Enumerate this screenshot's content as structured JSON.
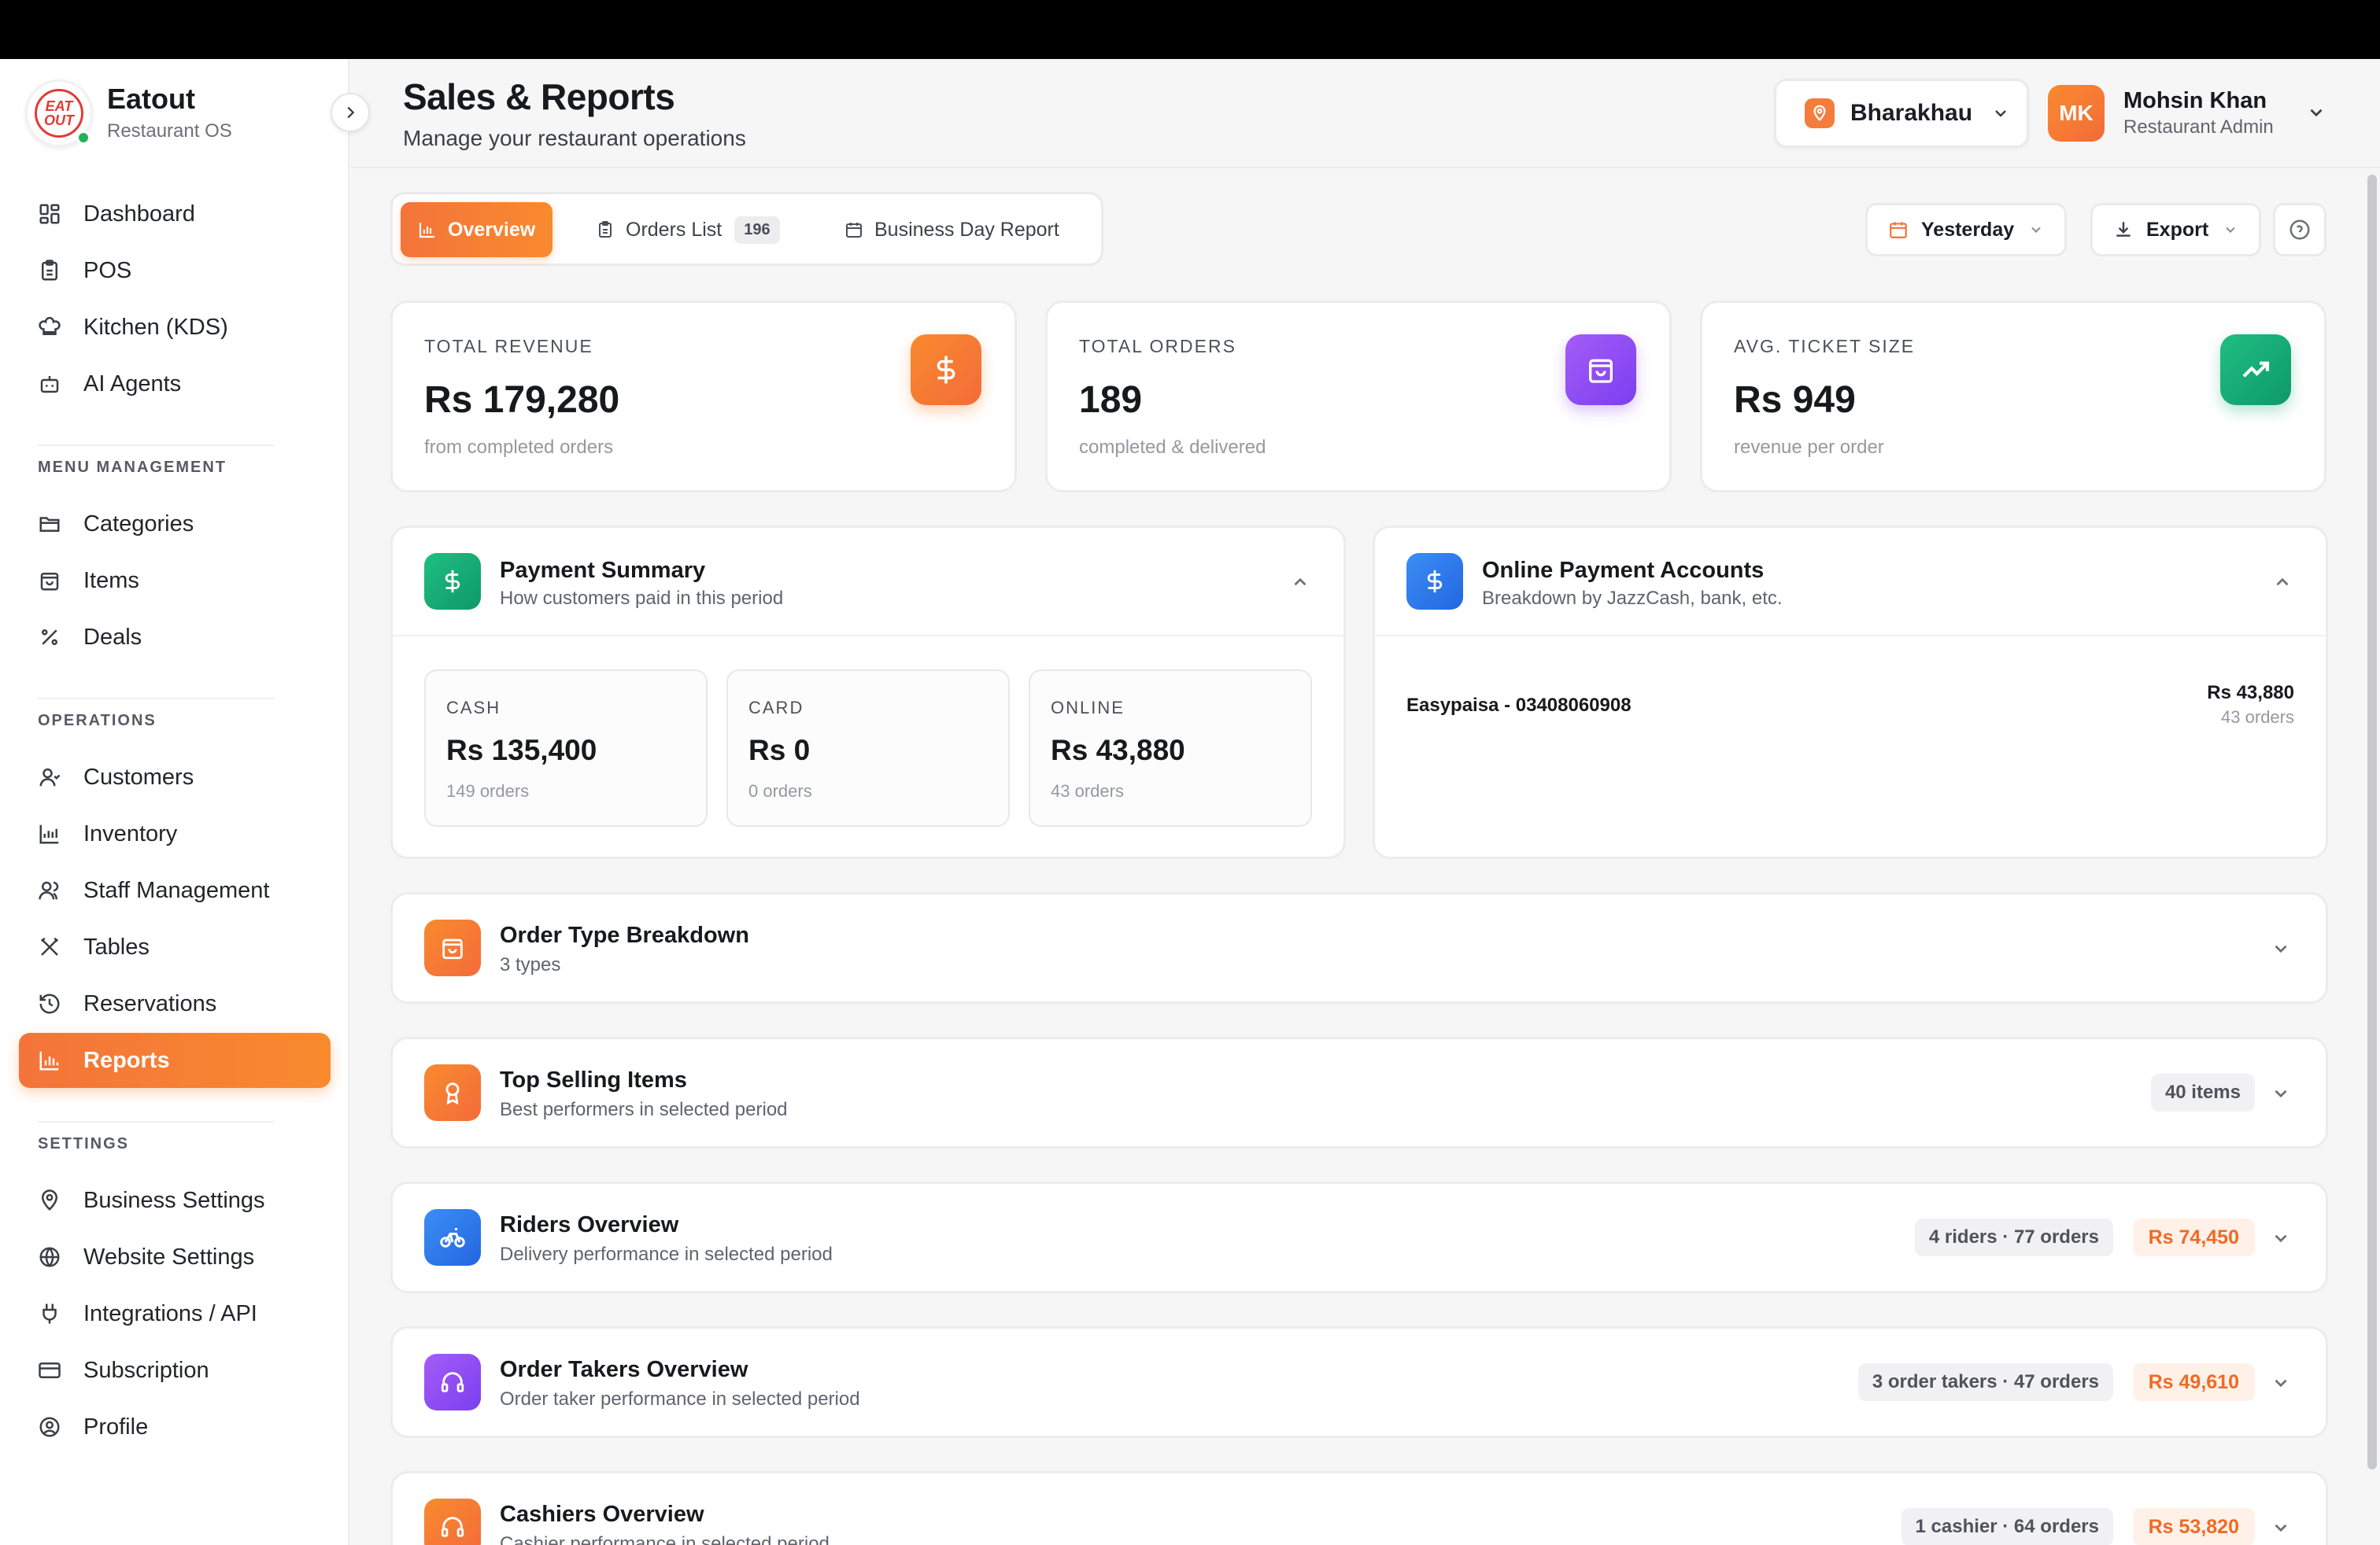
{
  "brand": {
    "name": "Eatout",
    "subtitle": "Restaurant OS",
    "logo_text": "EAT OUT"
  },
  "sidebar": {
    "main": [
      {
        "label": "Dashboard",
        "icon": "dashboard-icon"
      },
      {
        "label": "POS",
        "icon": "clipboard-icon"
      },
      {
        "label": "Kitchen (KDS)",
        "icon": "chef-hat-icon"
      },
      {
        "label": "AI Agents",
        "icon": "bot-icon"
      }
    ],
    "menu_section": "MENU MANAGEMENT",
    "menu": [
      {
        "label": "Categories",
        "icon": "folder-icon"
      },
      {
        "label": "Items",
        "icon": "bag-icon"
      },
      {
        "label": "Deals",
        "icon": "percent-icon"
      }
    ],
    "ops_section": "OPERATIONS",
    "ops": [
      {
        "label": "Customers",
        "icon": "user-icon"
      },
      {
        "label": "Inventory",
        "icon": "chart-icon"
      },
      {
        "label": "Staff Management",
        "icon": "users-icon"
      },
      {
        "label": "Tables",
        "icon": "utensils-icon"
      },
      {
        "label": "Reservations",
        "icon": "history-icon"
      },
      {
        "label": "Reports",
        "icon": "bar-chart-icon",
        "active": true
      }
    ],
    "settings_section": "SETTINGS",
    "settings": [
      {
        "label": "Business Settings",
        "icon": "map-pin-icon"
      },
      {
        "label": "Website Settings",
        "icon": "globe-icon"
      },
      {
        "label": "Integrations / API",
        "icon": "plug-icon"
      },
      {
        "label": "Subscription",
        "icon": "credit-card-icon"
      },
      {
        "label": "Profile",
        "icon": "user-circle-icon"
      }
    ]
  },
  "header": {
    "title": "Sales & Reports",
    "subtitle": "Manage your restaurant operations",
    "branch": "Bharakhau",
    "user_initials": "MK",
    "user_name": "Mohsin Khan",
    "user_role": "Restaurant Admin"
  },
  "tabs": [
    {
      "label": "Overview",
      "active": true
    },
    {
      "label": "Orders List",
      "badge": "196"
    },
    {
      "label": "Business Day Report"
    }
  ],
  "controls": {
    "date_range": "Yesterday",
    "export": "Export"
  },
  "stats": [
    {
      "label": "TOTAL REVENUE",
      "value": "Rs 179,280",
      "sub": "from completed orders",
      "color": "#f97a2e"
    },
    {
      "label": "TOTAL ORDERS",
      "value": "189",
      "sub": "completed & delivered",
      "color": "#8b45f0"
    },
    {
      "label": "AVG. TICKET SIZE",
      "value": "Rs 949",
      "sub": "revenue per order",
      "color": "#12a873"
    }
  ],
  "payment_summary": {
    "title": "Payment Summary",
    "subtitle": "How customers paid in this period",
    "boxes": [
      {
        "label": "CASH",
        "value": "Rs 135,400",
        "sub": "149 orders"
      },
      {
        "label": "CARD",
        "value": "Rs 0",
        "sub": "0 orders"
      },
      {
        "label": "ONLINE",
        "value": "Rs 43,880",
        "sub": "43 orders"
      }
    ]
  },
  "online_accounts": {
    "title": "Online Payment Accounts",
    "subtitle": "Breakdown by JazzCash, bank, etc.",
    "accounts": [
      {
        "name": "Easypaisa - 03408060908",
        "amount": "Rs 43,880",
        "orders": "43 orders"
      }
    ]
  },
  "sections": [
    {
      "title": "Order Type Breakdown",
      "subtitle": "3 types",
      "color": "#f98a2e",
      "icon": "bag-icon"
    },
    {
      "title": "Top Selling Items",
      "subtitle": "Best performers in selected period",
      "pill": "40 items",
      "color": "#f98a2e",
      "icon": "award-icon"
    },
    {
      "title": "Riders Overview",
      "subtitle": "Delivery performance in selected period",
      "pill": "4 riders · 77 orders",
      "amount": "Rs 74,450",
      "color": "#2f80ed",
      "icon": "bike-icon"
    },
    {
      "title": "Order Takers Overview",
      "subtitle": "Order taker performance in selected period",
      "pill": "3 order takers · 47 orders",
      "amount": "Rs 49,610",
      "color": "#8b45f0",
      "icon": "headset-icon"
    },
    {
      "title": "Cashiers Overview",
      "subtitle": "Cashier performance in selected period",
      "pill": "1 cashier · 64 orders",
      "amount": "Rs 53,820",
      "color": "#f98a2e",
      "icon": "headset-icon"
    }
  ]
}
